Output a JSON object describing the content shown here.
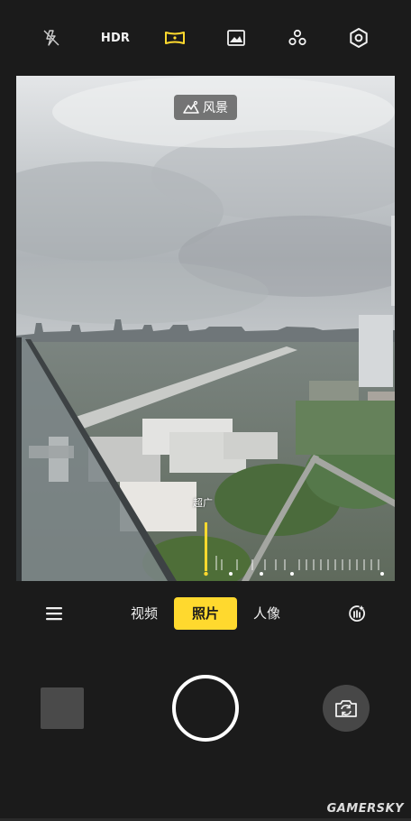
{
  "top_bar": {
    "hdr_label": "HDR",
    "icons": [
      "flash-off-icon",
      "hdr-icon",
      "panorama-icon",
      "image-icon",
      "filter-dots-icon",
      "settings-icon"
    ]
  },
  "viewfinder": {
    "scene_badge": "风景",
    "zoom_label": "超广"
  },
  "mode_bar": {
    "modes": [
      "视频",
      "照片",
      "人像"
    ],
    "selected_mode": "照片"
  },
  "watermark": "GAMERSKY",
  "colors": {
    "accent": "#ffd92e",
    "background": "#1b1b1b"
  }
}
